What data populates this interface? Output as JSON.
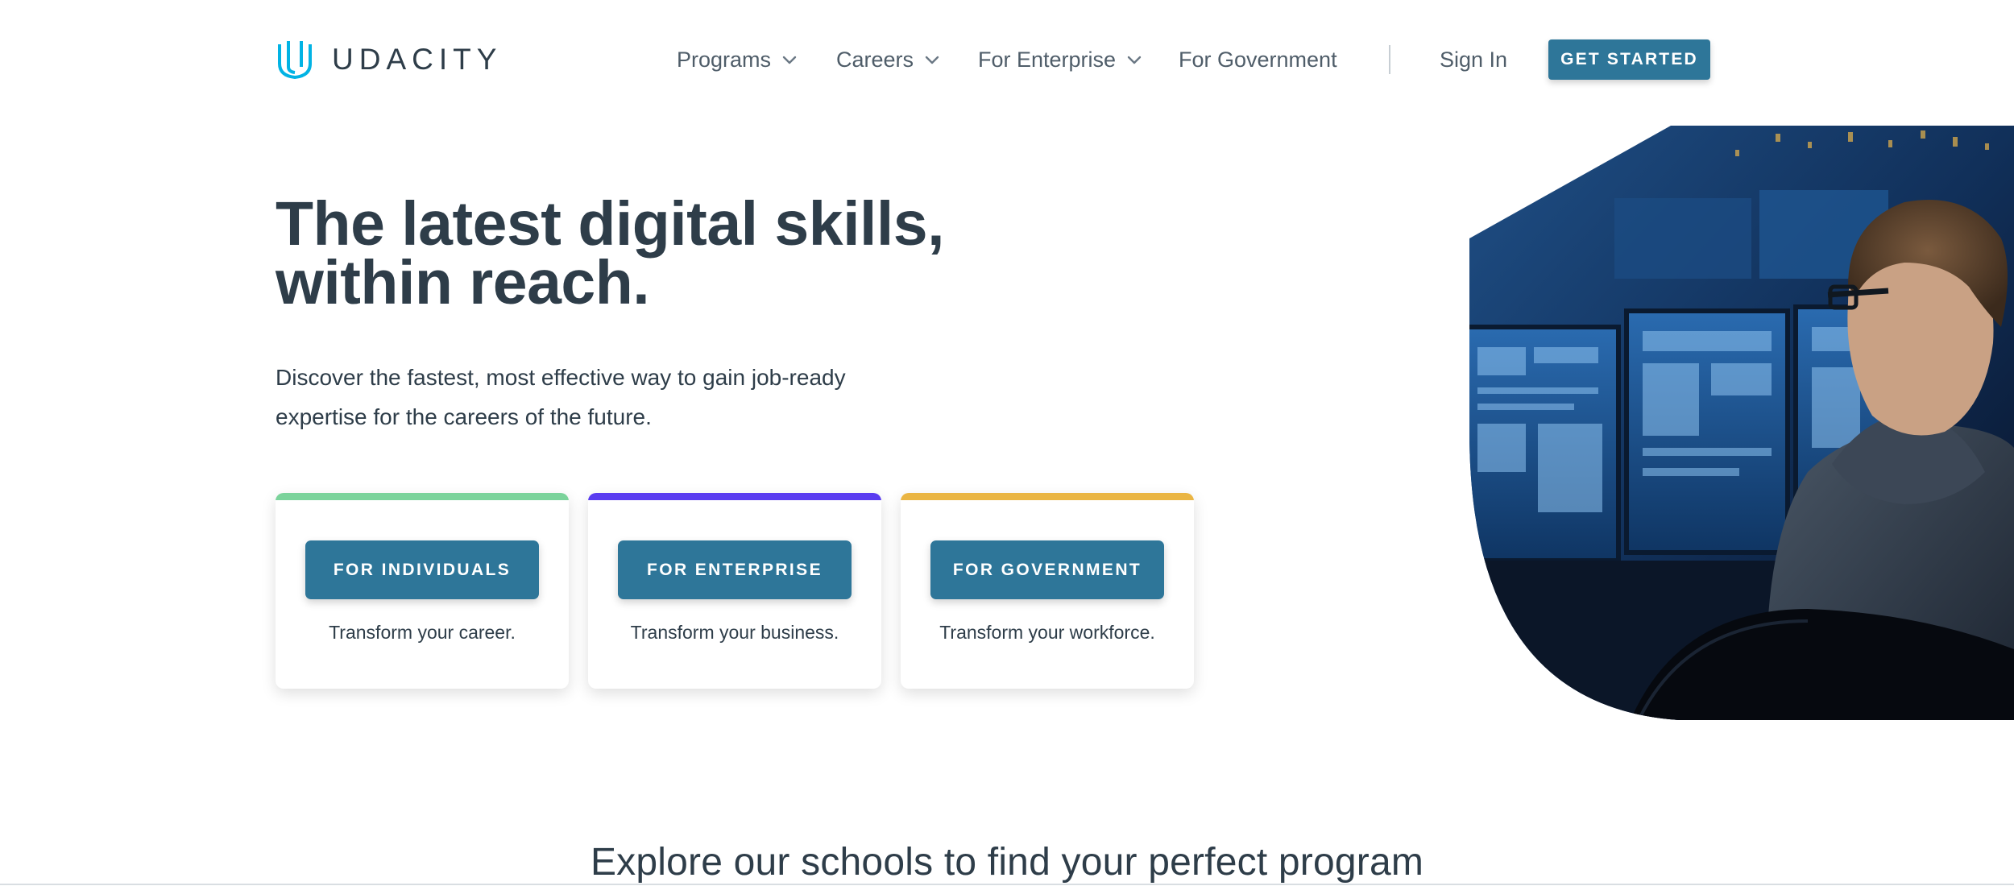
{
  "brand": {
    "name": "UDACITY"
  },
  "nav": {
    "programs": "Programs",
    "careers": "Careers",
    "enterprise": "For Enterprise",
    "government": "For Government",
    "sign_in": "Sign In",
    "get_started": "GET STARTED"
  },
  "hero": {
    "title_line1": "The latest digital skills,",
    "title_line2": "within reach.",
    "subtitle_line1": "Discover the fastest, most effective way to gain job-ready",
    "subtitle_line2": "expertise for the careers of the future."
  },
  "cards": [
    {
      "button": "FOR INDIVIDUALS",
      "description": "Transform your career.",
      "accent": "#7bd39b"
    },
    {
      "button": "FOR ENTERPRISE",
      "description": "Transform your business.",
      "accent": "#5a3cf0"
    },
    {
      "button": "FOR GOVERNMENT",
      "description": "Transform your workforce.",
      "accent": "#eab543"
    }
  ],
  "schools": {
    "heading": "Explore our schools to find your perfect program"
  },
  "colors": {
    "primary_button": "#2e7699",
    "text": "#2e3d49",
    "logo": "#02b3e4"
  },
  "icons": {
    "logo": "udacity-u-icon",
    "dropdown": "chevron-down-icon"
  }
}
